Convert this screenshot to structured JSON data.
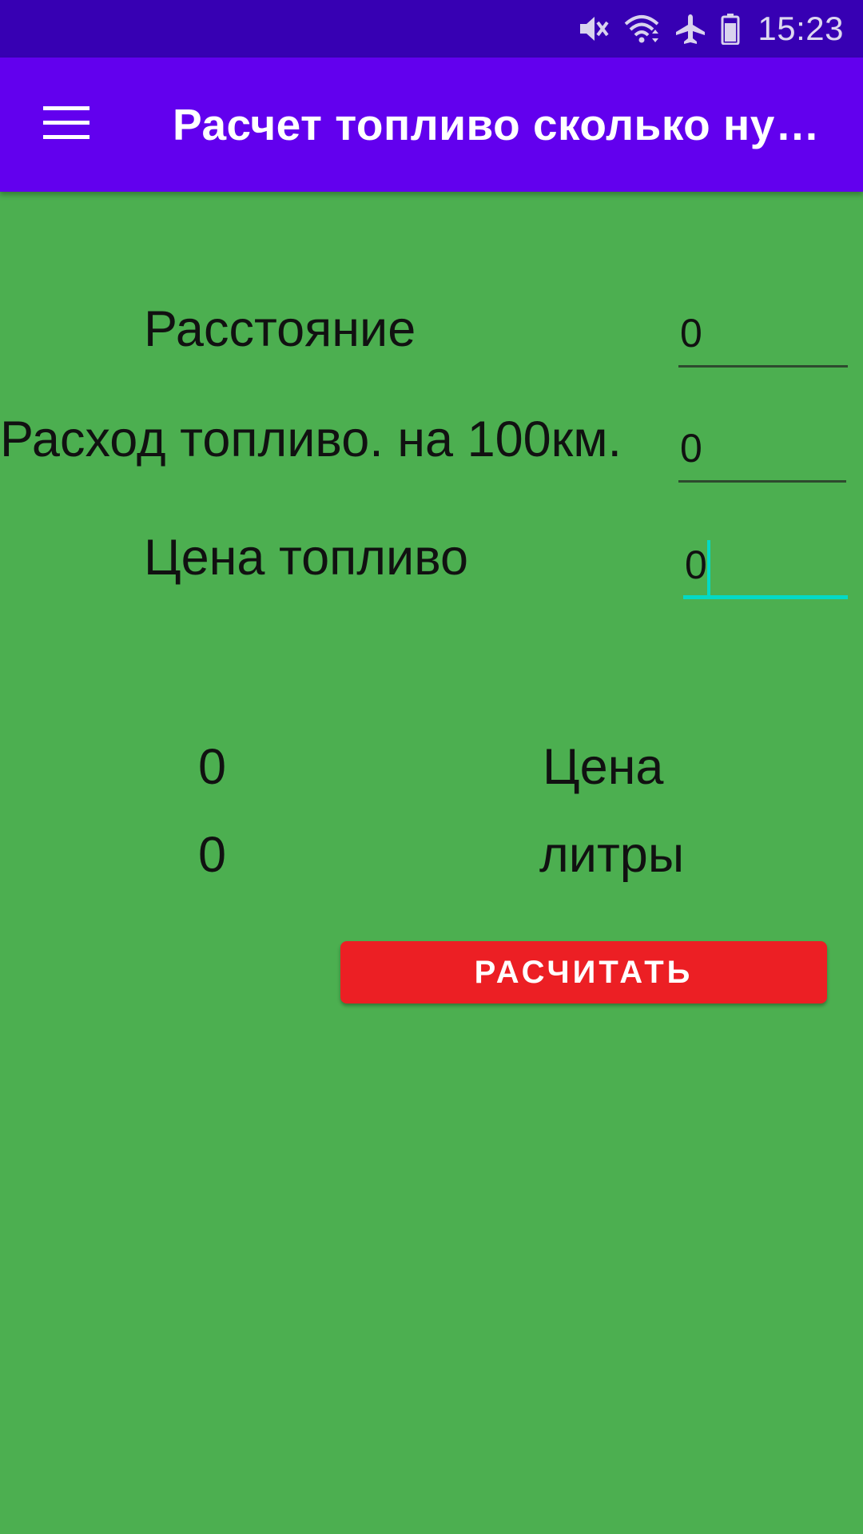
{
  "status_bar": {
    "time": "15:23",
    "icons": [
      "mute-icon",
      "wifi-icon",
      "airplane-mode-icon",
      "battery-icon"
    ]
  },
  "app_bar": {
    "title": "Расчет топливо сколько нужно",
    "menu_icon": "hamburger-menu-icon"
  },
  "form": {
    "distance_label": "Расстояние",
    "distance_value": "0",
    "consumption_label": "Расход топливо. на 100км.",
    "consumption_value": "0",
    "price_label": "Цена топливо",
    "price_value": "0"
  },
  "results": {
    "price_value": "0",
    "price_label": "Цена",
    "liters_value": "0",
    "liters_label": "литры"
  },
  "calculate_button": {
    "label": "РАСЧИТАТЬ"
  },
  "colors": {
    "status_bar": "#3700b3",
    "app_bar": "#6200ee",
    "background": "#4caf50",
    "button": "#ec1f24",
    "focus_accent": "#03dac6"
  }
}
